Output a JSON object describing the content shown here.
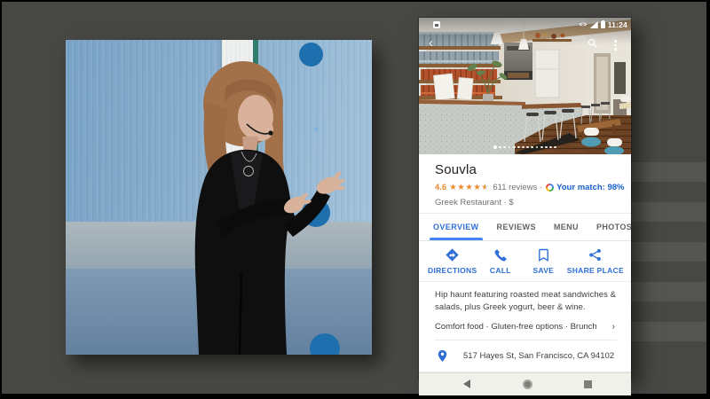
{
  "status_bar": {
    "time": "11:24",
    "icons": [
      "screenshot-icon",
      "code-icon",
      "signal-icon",
      "battery-icon"
    ]
  },
  "photo": {
    "dots_total": 14,
    "active_dot": 1,
    "overlay_icons": [
      "back-icon",
      "search-icon",
      "overflow-menu-icon"
    ]
  },
  "place": {
    "name": "Souvla",
    "rating": "4.6",
    "stars_full": "★★★★",
    "star_char": "★",
    "reviews_text": "611 reviews ·",
    "match_text": "Your match: 98%",
    "category_line": "Greek Restaurant · $"
  },
  "tabs": [
    {
      "label": "OVERVIEW",
      "active": true
    },
    {
      "label": "REVIEWS",
      "active": false
    },
    {
      "label": "MENU",
      "active": false
    },
    {
      "label": "PHOTOS",
      "active": false
    }
  ],
  "actions": [
    {
      "label": "DIRECTIONS",
      "icon": "directions-icon"
    },
    {
      "label": "CALL",
      "icon": "call-icon"
    },
    {
      "label": "SAVE",
      "icon": "save-icon"
    },
    {
      "label": "SHARE PLACE",
      "icon": "share-icon"
    }
  ],
  "overview": {
    "description": "Hip haunt featuring roasted meat sandwiches & salads, plus Greek yogurt, beer & wine.",
    "attributes": "Comfort food · Gluten-free options · Brunch",
    "chevron": "›",
    "address": "517 Hayes St, San Francisco, CA 94102"
  },
  "nav_bar": {
    "icons": [
      "back-icon",
      "home-icon",
      "recents-icon"
    ]
  },
  "colors": {
    "accent_blue": "#2f6fd6",
    "tab_underline": "#4285f4",
    "star_orange": "#ef8b2f",
    "match_blue": "#1a63cf",
    "text_primary": "#202124",
    "text_secondary": "#6f7276",
    "slide_background": "#474744",
    "stage_blue": "#88aecd",
    "stage_circle_blue": "#1e6fae",
    "teal_strip": "#2f7d6c"
  }
}
